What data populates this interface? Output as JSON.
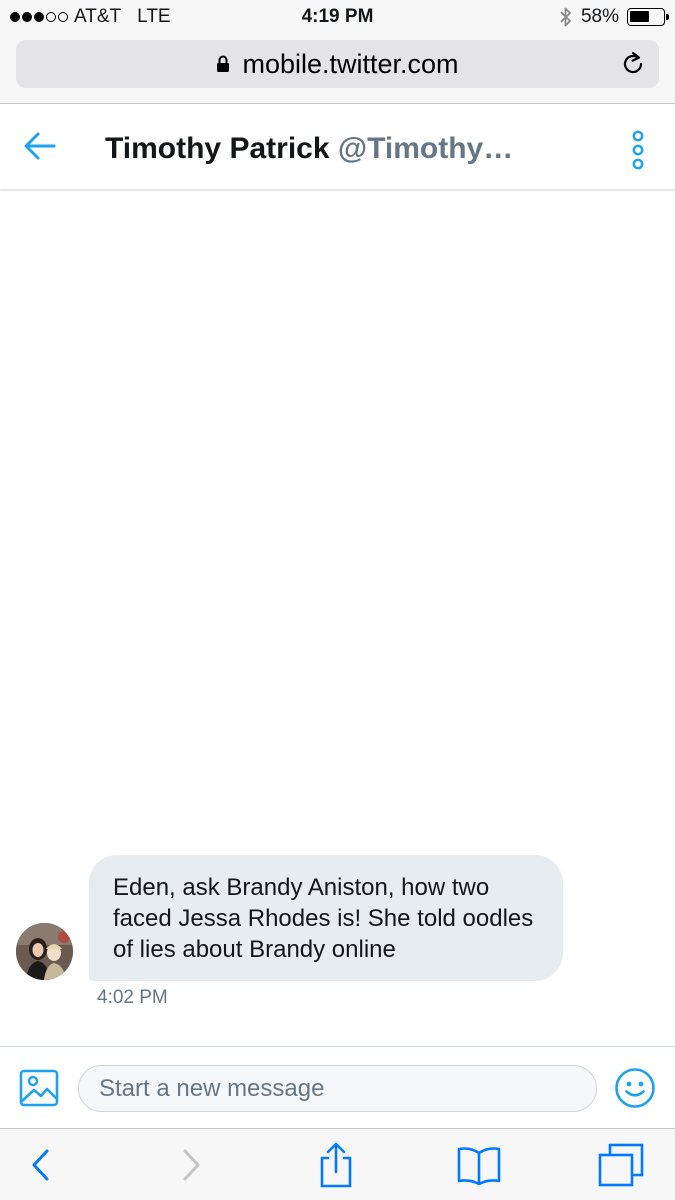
{
  "status_bar": {
    "carrier": "AT&T",
    "network": "LTE",
    "time": "4:19 PM",
    "battery_percent": "58%",
    "battery_level": 0.58,
    "signal_bars_filled": 3,
    "signal_bars_total": 5
  },
  "browser": {
    "url": "mobile.twitter.com"
  },
  "dm_header": {
    "name": "Timothy Patrick",
    "handle": "@Timothy…"
  },
  "conversation": {
    "messages": [
      {
        "text": "Eden, ask Brandy Aniston, how two faced Jessa Rhodes is! She told oodles of lies about Brandy online",
        "time": "4:02 PM"
      }
    ]
  },
  "composer": {
    "placeholder": "Start a new message"
  },
  "icons": {
    "back": "arrow-left-icon",
    "more": "vertical-dots-icon",
    "image": "image-icon",
    "emoji": "smiley-icon",
    "lock": "lock-icon",
    "reload": "reload-icon",
    "bluetooth": "bluetooth-icon",
    "safari_back": "chevron-left-icon",
    "safari_forward": "chevron-right-icon",
    "share": "share-icon",
    "bookmarks": "book-icon",
    "tabs": "tabs-icon"
  },
  "colors": {
    "twitter_blue": "#1da1f2",
    "bubble_bg": "#e6ecf0",
    "muted_text": "#657786",
    "safari_blue": "#007aff"
  }
}
